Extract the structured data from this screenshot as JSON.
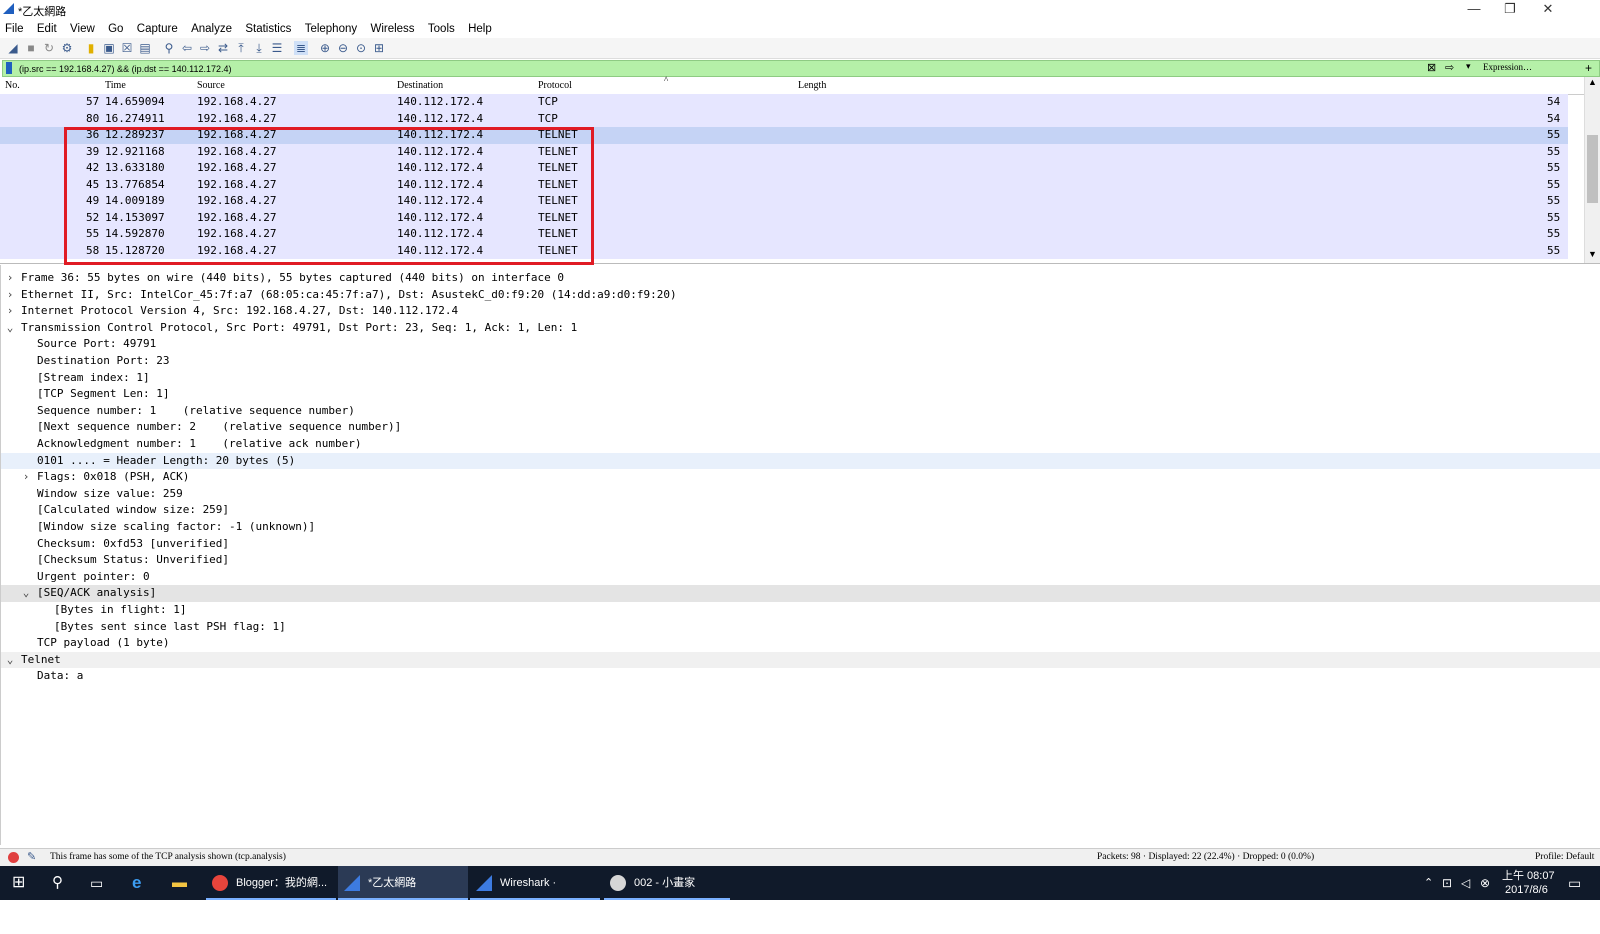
{
  "window": {
    "title": "*乙太網路",
    "minimize": "—",
    "restore": "❐",
    "close": "✕"
  },
  "menu": [
    "File",
    "Edit",
    "View",
    "Go",
    "Capture",
    "Analyze",
    "Statistics",
    "Telephony",
    "Wireless",
    "Tools",
    "Help"
  ],
  "filter": {
    "value": "(ip.src == 192.168.4.27) && (ip.dst == 140.112.172.4)",
    "expression_label": "Expression…",
    "plus": "+"
  },
  "columns": [
    "No.",
    "Time",
    "Source",
    "Destination",
    "Protocol",
    "Length"
  ],
  "packets": [
    {
      "no": "57",
      "time": "14.659094",
      "src": "192.168.4.27",
      "dst": "140.112.172.4",
      "proto": "TCP",
      "len": "54"
    },
    {
      "no": "80",
      "time": "16.274911",
      "src": "192.168.4.27",
      "dst": "140.112.172.4",
      "proto": "TCP",
      "len": "54"
    },
    {
      "no": "36",
      "time": "12.289237",
      "src": "192.168.4.27",
      "dst": "140.112.172.4",
      "proto": "TELNET",
      "len": "55"
    },
    {
      "no": "39",
      "time": "12.921168",
      "src": "192.168.4.27",
      "dst": "140.112.172.4",
      "proto": "TELNET",
      "len": "55"
    },
    {
      "no": "42",
      "time": "13.633180",
      "src": "192.168.4.27",
      "dst": "140.112.172.4",
      "proto": "TELNET",
      "len": "55"
    },
    {
      "no": "45",
      "time": "13.776854",
      "src": "192.168.4.27",
      "dst": "140.112.172.4",
      "proto": "TELNET",
      "len": "55"
    },
    {
      "no": "49",
      "time": "14.009189",
      "src": "192.168.4.27",
      "dst": "140.112.172.4",
      "proto": "TELNET",
      "len": "55"
    },
    {
      "no": "52",
      "time": "14.153097",
      "src": "192.168.4.27",
      "dst": "140.112.172.4",
      "proto": "TELNET",
      "len": "55"
    },
    {
      "no": "55",
      "time": "14.592870",
      "src": "192.168.4.27",
      "dst": "140.112.172.4",
      "proto": "TELNET",
      "len": "55"
    },
    {
      "no": "58",
      "time": "15.128720",
      "src": "192.168.4.27",
      "dst": "140.112.172.4",
      "proto": "TELNET",
      "len": "55"
    }
  ],
  "selected_packet_no": "36",
  "details": [
    {
      "arrow": "›",
      "text": "Frame 36: 55 bytes on wire (440 bits), 55 bytes captured (440 bits) on interface 0"
    },
    {
      "arrow": "›",
      "text": "Ethernet II, Src: IntelCor_45:7f:a7 (68:05:ca:45:7f:a7), Dst: AsustekC_d0:f9:20 (14:dd:a9:d0:f9:20)"
    },
    {
      "arrow": "›",
      "text": "Internet Protocol Version 4, Src: 192.168.4.27, Dst: 140.112.172.4"
    },
    {
      "arrow": "⌄",
      "text": "Transmission Control Protocol, Src Port: 49791, Dst Port: 23, Seq: 1, Ack: 1, Len: 1"
    },
    {
      "arrow": "",
      "text": "Source Port: 49791"
    },
    {
      "arrow": "",
      "text": "Destination Port: 23"
    },
    {
      "arrow": "",
      "text": "[Stream index: 1]"
    },
    {
      "arrow": "",
      "text": "[TCP Segment Len: 1]"
    },
    {
      "arrow": "",
      "text": "Sequence number: 1    (relative sequence number)"
    },
    {
      "arrow": "",
      "text": "[Next sequence number: 2    (relative sequence number)]"
    },
    {
      "arrow": "",
      "text": "Acknowledgment number: 1    (relative ack number)"
    },
    {
      "arrow": "",
      "text": "0101 .... = Header Length: 20 bytes (5)"
    },
    {
      "arrow": "›",
      "text": "Flags: 0x018 (PSH, ACK)"
    },
    {
      "arrow": "",
      "text": "Window size value: 259"
    },
    {
      "arrow": "",
      "text": "[Calculated window size: 259]"
    },
    {
      "arrow": "",
      "text": "[Window size scaling factor: -1 (unknown)]"
    },
    {
      "arrow": "",
      "text": "Checksum: 0xfd53 [unverified]"
    },
    {
      "arrow": "",
      "text": "[Checksum Status: Unverified]"
    },
    {
      "arrow": "",
      "text": "Urgent pointer: 0"
    },
    {
      "arrow": "⌄",
      "text": "[SEQ/ACK analysis]"
    },
    {
      "arrow": "",
      "text": "[Bytes in flight: 1]"
    },
    {
      "arrow": "",
      "text": "[Bytes sent since last PSH flag: 1]"
    },
    {
      "arrow": "",
      "text": "TCP payload (1 byte)"
    },
    {
      "arrow": "⌄",
      "text": "Telnet"
    },
    {
      "arrow": "",
      "text": "Data: a"
    }
  ],
  "status": {
    "message": "This frame has some of the TCP analysis shown (tcp.analysis)",
    "counts": "Packets: 98 · Displayed: 22 (22.4%) · Dropped: 0 (0.0%)",
    "profile": "Profile: Default"
  },
  "taskbar": {
    "apps": [
      "Blogger：我的網...",
      "*乙太網路",
      "Wireshark · Packet...",
      "002 - 小畫家"
    ],
    "time": "上午 08:07",
    "date": "2017/8/6"
  },
  "colors": {
    "filter_bg": "#b5f0a8",
    "row_bg": "#e6e6ff",
    "selected_row": "#c5d3f5",
    "highlight_box": "#e01b24",
    "taskbar": "#101a2a"
  }
}
